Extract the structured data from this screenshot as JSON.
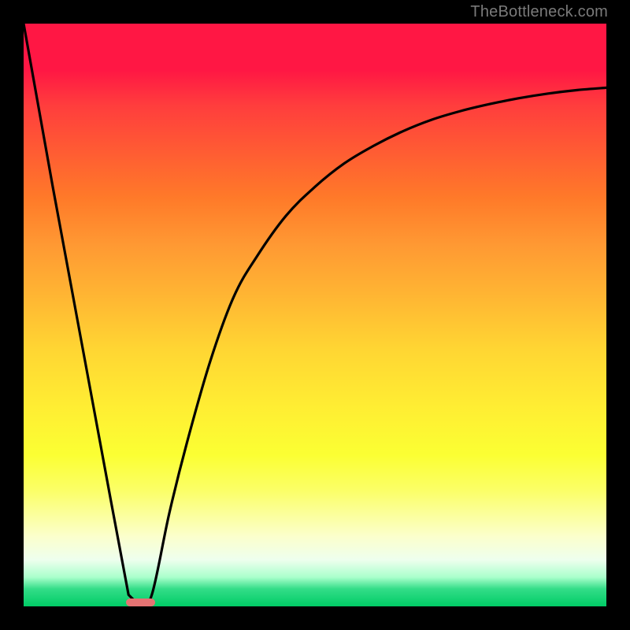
{
  "watermark": "TheBottleneck.com",
  "chart_data": {
    "type": "line",
    "title": "",
    "xlabel": "",
    "ylabel": "",
    "xlim": [
      0,
      100
    ],
    "ylim": [
      0,
      100
    ],
    "grid": false,
    "legend": false,
    "series": [
      {
        "name": "bottleneck-curve",
        "x": [
          0,
          5,
          10,
          15,
          18,
          20,
          22,
          25,
          28,
          32,
          36,
          40,
          45,
          50,
          55,
          60,
          65,
          70,
          75,
          80,
          85,
          90,
          95,
          100
        ],
        "values": [
          100,
          72,
          45,
          18,
          2,
          0,
          2,
          16,
          28,
          42,
          53,
          60,
          67,
          72,
          76,
          79,
          81.5,
          83.5,
          85,
          86.2,
          87.2,
          88,
          88.6,
          89
        ]
      }
    ],
    "annotations": [
      {
        "name": "bottleneck-marker",
        "x": 20,
        "width": 5,
        "y": 0,
        "color": "#e57373"
      }
    ],
    "colors": {
      "curve": "#000000",
      "background_top": "#ff1744",
      "background_bottom": "#00cc66",
      "marker": "#e57373"
    }
  }
}
